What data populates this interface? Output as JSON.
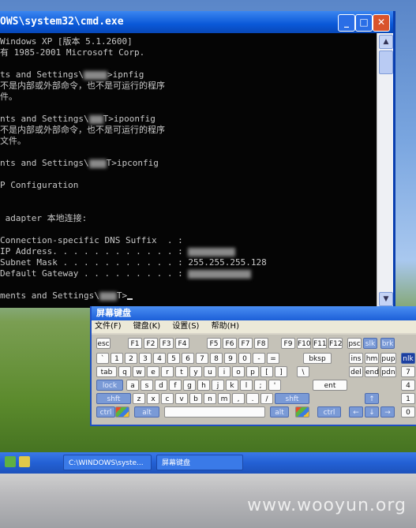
{
  "cmd": {
    "title": "OWS\\system32\\cmd.exe",
    "lines": [
      "Windows XP [版本 5.1.2600]",
      "有 1985-2001 Microsoft Corp.",
      "",
      "ts and Settings\\",
      "不是内部或外部命令，也不是可运行的程序",
      "件。",
      "",
      "nts and Settings\\",
      "不是内部或外部命令，也不是可运行的程序",
      "文件。",
      "",
      "nts and Settings\\",
      "",
      "P Configuration",
      "",
      "",
      " adapter 本地连接:",
      "",
      "Connection-specific DNS Suffix  . :",
      "IP Address. . . . . . . . . . . . :",
      "Subnet Mask . . . . . . . . . . . : 255.255.255.128",
      "Default Gateway . . . . . . . . . :",
      "",
      "ments and Settings\\"
    ],
    "cmd_suffixes": [
      ">ipnfig",
      "T>ipoonfig",
      "T>ipconfig",
      "T>"
    ]
  },
  "osk": {
    "title": "屏幕键盘",
    "menu": [
      "文件(F)",
      "键盘(K)",
      "设置(S)",
      "帮助(H)"
    ],
    "rows": [
      [
        "esc",
        "F1",
        "F2",
        "F3",
        "F4",
        "F5",
        "F6",
        "F7",
        "F8",
        "F9",
        "F10",
        "F11",
        "F12",
        "psc",
        "slk",
        "brk"
      ],
      [
        "`",
        "1",
        "2",
        "3",
        "4",
        "5",
        "6",
        "7",
        "8",
        "9",
        "0",
        "-",
        "=",
        "bksp",
        "ins",
        "hm",
        "pup",
        "nlk"
      ],
      [
        "tab",
        "q",
        "w",
        "e",
        "r",
        "t",
        "y",
        "u",
        "i",
        "o",
        "p",
        "[",
        "]",
        "\\",
        "del",
        "end",
        "pdn",
        "7"
      ],
      [
        "lock",
        "a",
        "s",
        "d",
        "f",
        "g",
        "h",
        "j",
        "k",
        "l",
        ";",
        "'",
        "ent",
        "4"
      ],
      [
        "shft",
        "z",
        "x",
        "c",
        "v",
        "b",
        "n",
        "m",
        ",",
        ".",
        "/",
        "shft",
        "1"
      ],
      [
        "ctrl",
        "alt",
        "alt",
        "ctrl",
        "0"
      ]
    ]
  },
  "taskbar": {
    "items": [
      "C:\\WINDOWS\\syste...",
      "屏幕键盘"
    ]
  },
  "watermark": "www.wooyun.org"
}
